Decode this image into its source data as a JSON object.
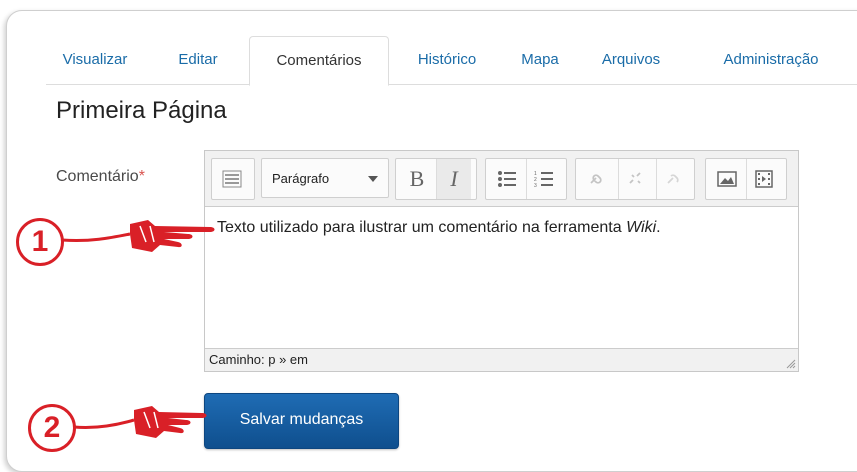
{
  "tabs": [
    "Visualizar",
    "Editar",
    "Comentários",
    "Histórico",
    "Mapa",
    "Arquivos",
    "Administração"
  ],
  "active_tab": "Comentários",
  "page_title": "Primeira Página",
  "form": {
    "comment_label": "Comentário",
    "required_mark": "*"
  },
  "editor": {
    "format_value": "Parágrafo",
    "content_text": "Texto utilizado para ilustrar um comentário na ferramenta ",
    "content_emphasis": "Wiki",
    "content_end": ".",
    "path_label": "Caminho: p » em",
    "toolbar_icons": [
      "toolbar-toggle-icon",
      "bold-icon",
      "italic-icon",
      "bullet-list-icon",
      "numbered-list-icon",
      "link-icon",
      "unlink-icon",
      "anchor-icon",
      "image-icon",
      "media-icon"
    ]
  },
  "save_button": "Salvar mudanças",
  "callouts": [
    "1",
    "2"
  ],
  "colors": {
    "accent": "#1a6ca8",
    "button": "#1a5ea1",
    "callout": "#d92027",
    "required": "#d9534f"
  }
}
